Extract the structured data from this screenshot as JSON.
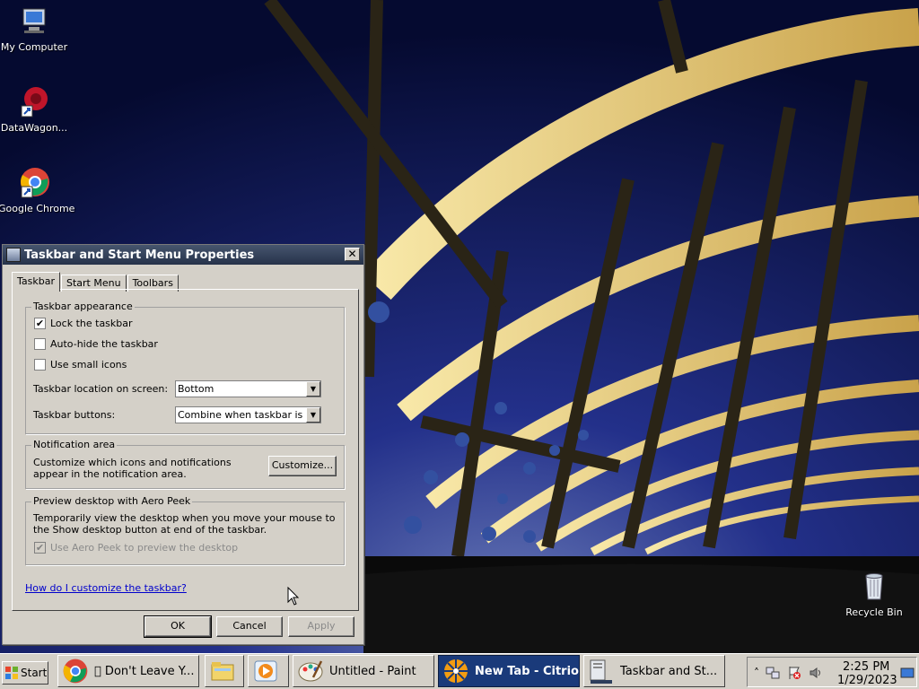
{
  "desktop": {
    "icons": [
      {
        "label": "My Computer",
        "icon": "computer-icon"
      },
      {
        "label": "DataWagon...",
        "icon": "datawagon-icon"
      },
      {
        "label": "Google Chrome",
        "icon": "chrome-icon"
      },
      {
        "label": "Recycle Bin",
        "icon": "recycle-bin-icon"
      }
    ]
  },
  "dialog": {
    "title": "Taskbar and Start Menu Properties",
    "close_glyph": "✕",
    "tabs": [
      {
        "label": "Taskbar",
        "active": true
      },
      {
        "label": "Start Menu",
        "active": false
      },
      {
        "label": "Toolbars",
        "active": false
      }
    ],
    "appearance": {
      "group_label": "Taskbar appearance",
      "lock": {
        "label": "Lock the taskbar",
        "checked": true
      },
      "autohide": {
        "label": "Auto-hide the taskbar",
        "checked": false
      },
      "small_icons": {
        "label": "Use small icons",
        "checked": false
      },
      "location_label": "Taskbar location on screen:",
      "location_value": "Bottom",
      "buttons_label": "Taskbar buttons:",
      "buttons_value": "Combine when taskbar is full"
    },
    "notification": {
      "group_label": "Notification area",
      "description": "Customize which icons and notifications appear in the notification area.",
      "customize_label": "Customize..."
    },
    "aero_peek": {
      "group_label": "Preview desktop with Aero Peek",
      "description": "Temporarily view the desktop when you move your mouse to the Show desktop button at end of the taskbar.",
      "checkbox_label": "Use Aero Peek to preview the desktop",
      "checked": true,
      "disabled": true
    },
    "help_link": "How do I customize the taskbar?",
    "ok_label": "OK",
    "cancel_label": "Cancel",
    "apply_label": "Apply",
    "check_glyph": "✔"
  },
  "taskbar": {
    "start_label": "Start",
    "buttons": [
      {
        "label": "\u0000 Don't Leave Y...",
        "icon": "chrome-icon",
        "active": false
      },
      {
        "label": "",
        "icon": "file-explorer-icon",
        "active": false
      },
      {
        "label": "",
        "icon": "media-player-icon",
        "active": false
      },
      {
        "label": "Untitled - Paint",
        "icon": "paint-icon",
        "active": false
      },
      {
        "label": "New Tab - Citrio",
        "icon": "citrio-icon",
        "active": true
      },
      {
        "label": "Taskbar and St...",
        "icon": "taskbar-properties-icon",
        "active": false
      }
    ],
    "clock_time": "2:25 PM",
    "clock_date": "1/29/2023"
  }
}
